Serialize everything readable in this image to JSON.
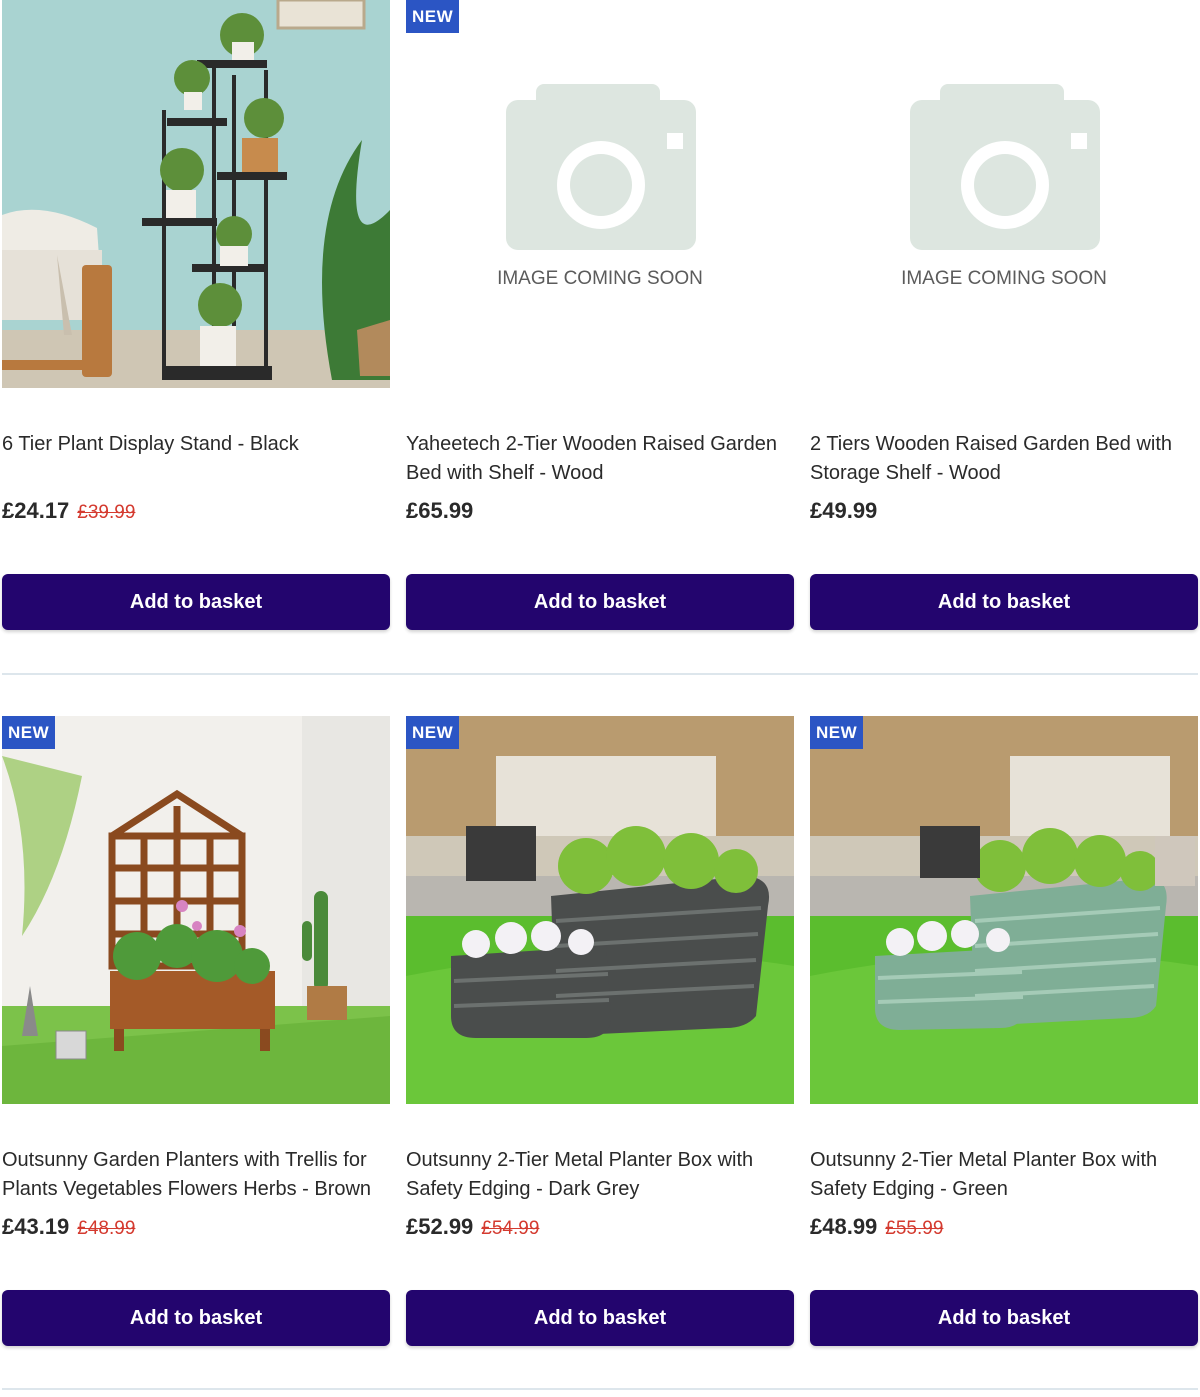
{
  "products": [
    {
      "badge": "",
      "image": "plant-display-stand-photo",
      "title": "6 Tier Plant Display Stand - Black",
      "price": "£24.17",
      "was_price": "£39.99",
      "button_label": "Add to basket"
    },
    {
      "badge": "NEW",
      "image": "image-coming-soon-placeholder",
      "placeholder_text": "IMAGE COMING SOON",
      "title": "Yaheetech 2-Tier Wooden Raised Garden Bed with Shelf - Wood",
      "price": "£65.99",
      "was_price": "",
      "button_label": "Add to basket"
    },
    {
      "badge": "",
      "image": "image-coming-soon-placeholder",
      "placeholder_text": "IMAGE COMING SOON",
      "title": "2 Tiers Wooden Raised Garden Bed with Storage Shelf - Wood",
      "price": "£49.99",
      "was_price": "",
      "button_label": "Add to basket"
    },
    {
      "badge": "NEW",
      "image": "trellis-planter-photo",
      "title": "Outsunny Garden Planters with Trellis for Plants Vegetables Flowers Herbs - Brown",
      "price": "£43.19",
      "was_price": "£48.99",
      "button_label": "Add to basket"
    },
    {
      "badge": "NEW",
      "image": "metal-planter-dark-grey-photo",
      "title": "Outsunny 2-Tier Metal Planter Box with Safety Edging - Dark Grey",
      "price": "£52.99",
      "was_price": "£54.99",
      "button_label": "Add to basket"
    },
    {
      "badge": "NEW",
      "image": "metal-planter-green-photo",
      "title": "Outsunny 2-Tier Metal Planter Box with Safety Edging - Green",
      "price": "£48.99",
      "was_price": "£55.99",
      "button_label": "Add to basket"
    }
  ],
  "colors": {
    "button": "#23056e",
    "badge": "#2b55c4",
    "was_price": "#d43a2f",
    "divider": "#dde6ec"
  }
}
